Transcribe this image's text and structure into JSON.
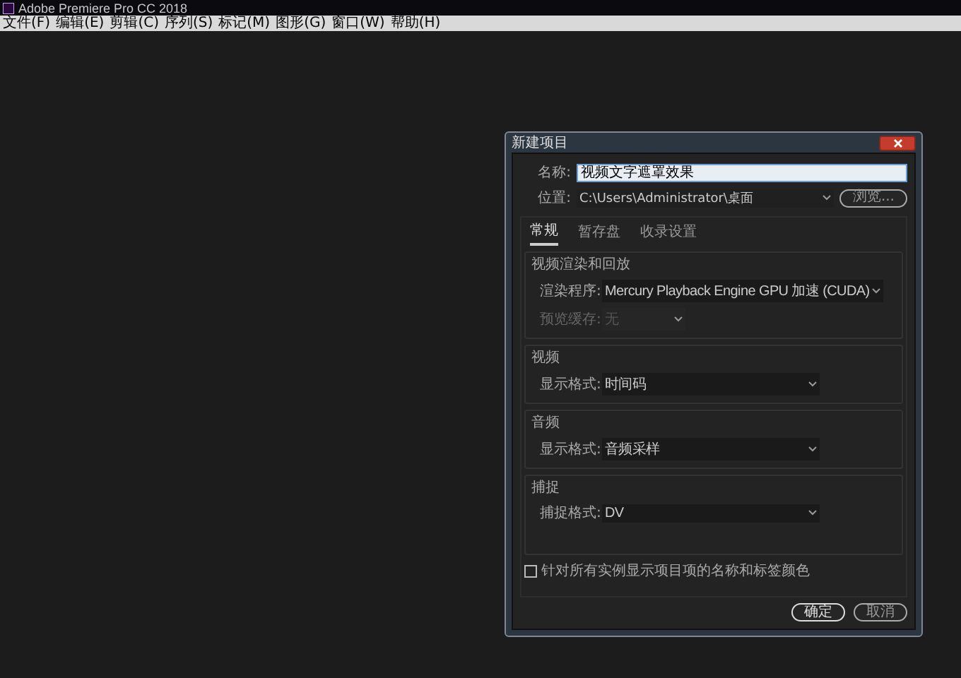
{
  "window": {
    "title": "Adobe Premiere Pro CC 2018"
  },
  "menu": [
    "文件(F)",
    "编辑(E)",
    "剪辑(C)",
    "序列(S)",
    "标记(M)",
    "图形(G)",
    "窗口(W)",
    "帮助(H)"
  ],
  "dialog": {
    "title": "新建项目",
    "name_label": "名称:",
    "name_value": "视频文字遮罩效果",
    "location_label": "位置:",
    "location_value": "C:\\Users\\Administrator\\桌面",
    "browse": "浏览...",
    "tabs": [
      {
        "label": "常规",
        "selected": true
      },
      {
        "label": "暂存盘",
        "selected": false
      },
      {
        "label": "收录设置",
        "selected": false
      }
    ],
    "sections": [
      {
        "title": "视频渲染和回放",
        "fields": [
          {
            "label": "渲染程序:",
            "value": "Mercury Playback Engine GPU 加速 (CUDA)",
            "disabled": false
          },
          {
            "label": "预览缓存:",
            "value": "无",
            "disabled": true
          }
        ]
      },
      {
        "title": "视频",
        "fields": [
          {
            "label": "显示格式:",
            "value": "时间码",
            "disabled": false
          }
        ]
      },
      {
        "title": "音频",
        "fields": [
          {
            "label": "显示格式:",
            "value": "音频采样",
            "disabled": false
          }
        ]
      },
      {
        "title": "捕捉",
        "fields": [
          {
            "label": "捕捉格式:",
            "value": "DV",
            "disabled": false
          }
        ]
      }
    ],
    "checkbox": {
      "label": "针对所有实例显示项目项的名称和标签颜色",
      "checked": false
    },
    "ok": "确定",
    "cancel": "取消"
  }
}
